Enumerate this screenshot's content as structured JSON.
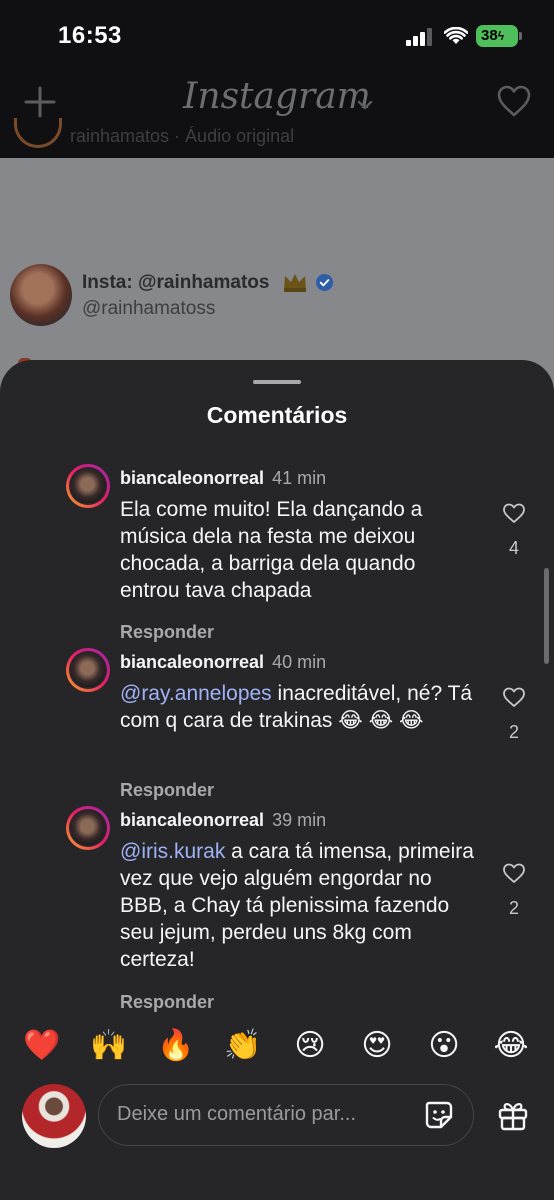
{
  "status_bar": {
    "time": "16:53",
    "battery": "38"
  },
  "nav": {
    "title": "Instagram"
  },
  "background_post": {
    "ghost_line": "rainhamatos · Áudio original",
    "name": "Insta: @rainhamatos",
    "handle": "@rainhamatoss"
  },
  "sheet": {
    "title": "Comentários"
  },
  "comments": [
    {
      "user": "biancaleonorreal",
      "time": "41 min",
      "mention": "",
      "text": "Ela come muito! Ela dançando a música dela na festa me deixou chocada, a barriga dela quando entrou tava chapada",
      "reply": "Responder",
      "likes": "4"
    },
    {
      "user": "biancaleonorreal",
      "time": "40 min",
      "mention": "@ray.annelopes",
      "text": " inacreditável, né? Tá com q cara de trakinas 😂 😂 😂",
      "reply": "Responder",
      "likes": "2"
    },
    {
      "user": "biancaleonorreal",
      "time": "39 min",
      "mention": "@iris.kurak",
      "text": " a cara tá imensa, primeira vez que vejo alguém engordar no BBB, a Chay tá plenissima fazendo seu jejum, perdeu uns 8kg com certeza!",
      "reply": "Responder",
      "likes": "2"
    }
  ],
  "reactions": [
    "❤️",
    "🙌",
    "🔥",
    "👏",
    "😢",
    "😍",
    "😮",
    "😂"
  ],
  "composer": {
    "placeholder": "Deixe um comentário par..."
  }
}
